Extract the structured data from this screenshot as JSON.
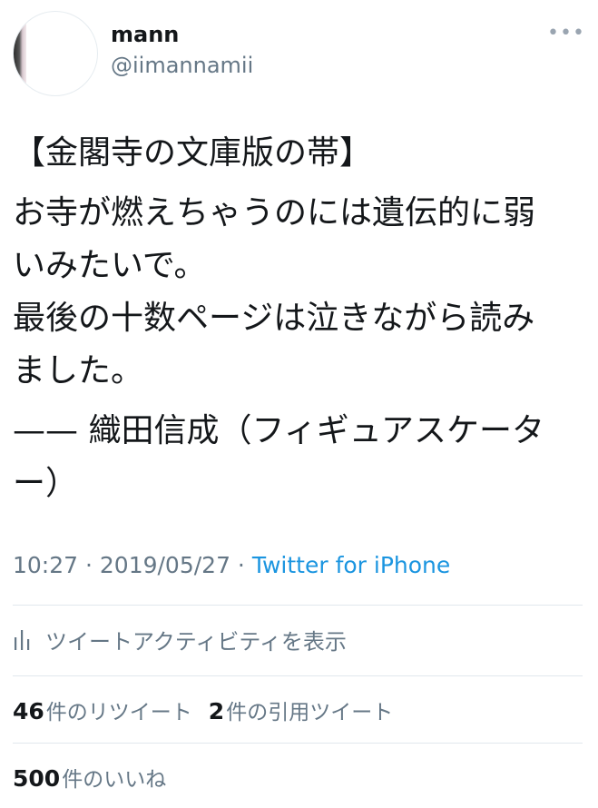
{
  "user": {
    "display_name": "mann",
    "handle": "@iimannamii"
  },
  "header": {
    "more_icon": "more-horizontal-icon"
  },
  "tweet": {
    "lines": [
      "【金閣寺の文庫版の帯】",
      "お寺が燃えちゃうのには遺伝的に弱",
      "いみたいで。",
      "最後の十数ページは泣きながら読み",
      "ました。",
      "—— 織田信成（フィギュアスケータ",
      "ー）"
    ],
    "time": "10:27",
    "separator": " · ",
    "date": "2019/05/27",
    "source": "Twitter for iPhone"
  },
  "activity": {
    "icon": "bar-chart-icon",
    "label": "ツイートアクティビティを表示"
  },
  "stats": {
    "retweets_count": "46",
    "retweets_label": "件のリツイート",
    "quotes_count": "2",
    "quotes_label": "件の引用ツイート",
    "likes_count": "500",
    "likes_label": "件のいいね"
  },
  "colors": {
    "text": "#14171a",
    "secondary": "#657786",
    "link": "#1b95e0",
    "divider": "#e1e8ed"
  }
}
